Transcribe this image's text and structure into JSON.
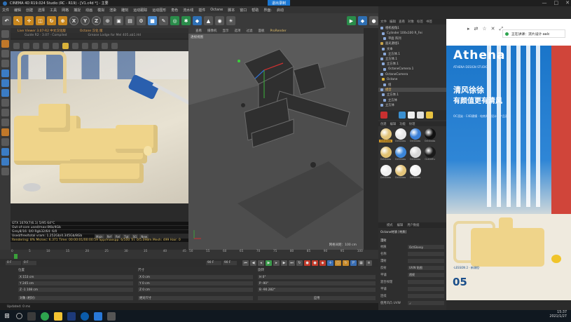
{
  "window": {
    "title": "CINEMA 4D R19.024 Studio (RC - R19) - [V1.c4d *] - 主要",
    "recording_badge": "退出录制",
    "controls": [
      "—",
      "□",
      "✕"
    ]
  },
  "menubar": [
    "文件",
    "编辑",
    "创建",
    "选择",
    "工具",
    "网格",
    "捕捉",
    "动画",
    "模拟",
    "渲染",
    "雕刻",
    "运动跟踪",
    "运动图形",
    "角色",
    "流水线",
    "插件",
    "Octane",
    "脚本",
    "窗口",
    "帮助",
    "界面:",
    "启动"
  ],
  "toolbar": {
    "buttons": [
      {
        "icon": "undo-icon",
        "glyph": "↶",
        "style": ""
      },
      {
        "icon": "select-icon",
        "glyph": "↖",
        "style": "o"
      },
      {
        "icon": "move-icon",
        "glyph": "✛",
        "style": "o"
      },
      {
        "icon": "scale-icon",
        "glyph": "◫",
        "style": "o"
      },
      {
        "icon": "rotate-icon",
        "glyph": "↻",
        "style": "o"
      },
      {
        "icon": "recent-icon",
        "glyph": "⊕",
        "style": "o"
      },
      {
        "icon": "x-axis-icon",
        "glyph": "X",
        "style": "xyz"
      },
      {
        "icon": "y-axis-icon",
        "glyph": "Y",
        "style": "xyz"
      },
      {
        "icon": "z-axis-icon",
        "glyph": "Z",
        "style": "xyz"
      },
      {
        "icon": "coord-system-icon",
        "glyph": "⊙",
        "style": ""
      },
      {
        "icon": "render-view-icon",
        "glyph": "▣",
        "style": ""
      },
      {
        "icon": "render-picture-icon",
        "glyph": "▤",
        "style": ""
      },
      {
        "icon": "render-settings-icon",
        "glyph": "⚙",
        "style": ""
      },
      {
        "icon": "cube-icon",
        "glyph": "■",
        "style": "cube"
      },
      {
        "icon": "pen-icon",
        "glyph": "✎",
        "style": ""
      },
      {
        "icon": "subdivision-icon",
        "glyph": "◎",
        "style": "g"
      },
      {
        "icon": "array-icon",
        "glyph": "✱",
        "style": "g"
      },
      {
        "icon": "deformer-icon",
        "glyph": "◆",
        "style": "b"
      },
      {
        "icon": "environment-icon",
        "glyph": "▲",
        "style": ""
      },
      {
        "icon": "camera-icon",
        "glyph": "◉",
        "style": ""
      },
      {
        "icon": "light-icon",
        "glyph": "☀",
        "style": ""
      }
    ],
    "right_buttons": [
      {
        "icon": "octane-live-icon",
        "glyph": "▶",
        "style": "g"
      },
      {
        "icon": "octane-settings-icon",
        "glyph": "◆",
        "style": "b"
      },
      {
        "icon": "octane-record-icon",
        "glyph": "●",
        "style": ""
      }
    ]
  },
  "left_panel": {
    "header": [
      "Live Viewer 3.07-R2 中文汉化版",
      "Octane 汉化 版"
    ],
    "subheader": [
      "Guide R2 · 3.07 · Compiled",
      "Grease Lodge for Mel 405.ab1.Hd"
    ],
    "stats": [
      "GTX 1070(7(6.1)        5/95         64°C",
      "Out-of-core used/max:0Kb/4Gb",
      "Grey8/16: 0/0        Rgb32/64: 6/0",
      "Used/free/total vram: 1.252Gb/4.345Gb/8Gb",
      "Rendering: 8%   Ms/sec: 6.371   Time: 00:00:01/00:00:59   Spp/maxspp: 6/500   Tri: 0/5.098m   Mesh: 499   Hair: 0"
    ],
    "mode_tabs": [
      "Main",
      "Ref",
      "Rel",
      "Tgt",
      "SG",
      "New"
    ]
  },
  "viewport": {
    "menu": [
      "查看",
      "摄像机",
      "显示",
      "选项",
      "过滤",
      "面板",
      "ProRender"
    ],
    "highlight_index": 6,
    "label": "透视视图",
    "footer_left": "网格间距：100 cm",
    "footer_right": ""
  },
  "right_panel": {
    "tabs": [
      "文件",
      "编辑",
      "查看",
      "对象",
      "标签",
      "书签"
    ],
    "objects": [
      {
        "name": "相机视角1",
        "color": "#8aa8d8",
        "hl": false
      },
      {
        "name": "Cylinder 100x100 R_Fei",
        "color": "#8aa8d8",
        "hl": false
      },
      {
        "name": "平面 阵列",
        "color": "#8aa8d8",
        "hl": false
      },
      {
        "name": "面光源组1",
        "color": "#c8a24a",
        "hl": false
      },
      {
        "name": "文本",
        "color": "#8aa8d8",
        "hl": false
      },
      {
        "name": "立方体.1",
        "color": "#8aa8d8",
        "hl": false
      },
      {
        "name": "立方体.1",
        "color": "#8aa8d8",
        "hl": false
      },
      {
        "name": "立方体.1",
        "color": "#8aa8d8",
        "hl": false
      },
      {
        "name": "OctaneCamera.1",
        "color": "#8aa8d8",
        "hl": false
      },
      {
        "name": "OctaneCamera",
        "color": "#8aa8d8",
        "hl": false
      },
      {
        "name": "Octane",
        "color": "#d9b23a",
        "hl": false
      },
      {
        "name": "组",
        "color": "#8aa8d8",
        "hl": false
      },
      {
        "name": "模型",
        "color": "#8aa8d8",
        "hl": true
      },
      {
        "name": "立方体.1",
        "color": "#8aa8d8",
        "hl": false
      },
      {
        "name": "立方体",
        "color": "#8aa8d8",
        "hl": false
      },
      {
        "name": "立方体",
        "color": "#8aa8d8",
        "hl": false
      }
    ],
    "material_toolbar_colors": [
      "#c83030",
      "#2b2b2b",
      "#3a8fd0",
      "#eeeeee",
      "#e0e0e0",
      "#e8c240"
    ],
    "material_tabs": [
      "创建",
      "编辑",
      "功能",
      "纹理"
    ],
    "materials": [
      {
        "name": "OctGloss",
        "color": "#e2c47a",
        "sel": true
      },
      {
        "name": "OctGloss",
        "color": "#e8e8e8",
        "sel": false
      },
      {
        "name": "OctGloss",
        "color": "#3a7fd6",
        "sel": false
      },
      {
        "name": "OctGloss",
        "color": "#111111",
        "sel": false
      },
      {
        "name": "OctGloss",
        "color": "#e0c070",
        "sel": false
      },
      {
        "name": "OctGloss",
        "color": "#3b85d8",
        "sel": false
      },
      {
        "name": "OctGloss",
        "color": "#d8d8d8",
        "sel": false
      },
      {
        "name": "OctDiffu",
        "color": "#1a1a1a",
        "sel": false
      },
      {
        "name": "OctGloss",
        "color": "#efefef",
        "sel": false
      },
      {
        "name": "OctGloss",
        "color": "#e4c57b",
        "sel": false
      },
      {
        "name": "OctGloss",
        "color": "#f2f2f2",
        "sel": false
      }
    ],
    "attr_tabs": [
      "模式",
      "编辑",
      "用户数据"
    ],
    "attr_title": "Octane材质 [材质]",
    "attr_section": "漫射",
    "attr_rows": [
      {
        "label": "材质",
        "value": "OctGlossy"
      },
      {
        "label": "名称",
        "value": ""
      },
      {
        "label": "漫射",
        "value": ""
      },
      {
        "label": "反射",
        "value": "UVW 贴图"
      },
      {
        "label": "平铺",
        "value": "透视"
      },
      {
        "label": "混合纹理",
        "value": ""
      },
      {
        "label": "平铺",
        "value": ""
      },
      {
        "label": "连续",
        "value": ""
      },
      {
        "label": "使用凹凸 UVW",
        "value": "✓"
      }
    ]
  },
  "right_strip": {
    "icons": [
      "▸",
      "⇄",
      "☆",
      "✕",
      "⤢"
    ],
    "notification": "正在讲课：流片设计·aalc"
  },
  "poster": {
    "title": "Athena",
    "small1": "ATHENA DESIGN STUDIO",
    "line1": "清风徐徐",
    "line2": "有颜值更有清风",
    "small2": "OC渲染 · C4D建模 · 电商海报设计 · 产品渲染",
    "small3": "·LESSON 2 · 新课程·",
    "number": "05"
  },
  "timeline": {
    "left_scale": [
      "0",
      "5",
      "10",
      "15",
      "20",
      "25",
      "30",
      "35",
      "40",
      "45"
    ],
    "right_scale": [
      "50",
      "55",
      "60",
      "65",
      "70",
      "75",
      "80",
      "85",
      "90",
      "95",
      "100"
    ]
  },
  "transport": {
    "start": "0 F",
    "current": "0 F",
    "end": "90 F",
    "end2": "90 F",
    "fps": "0 F"
  },
  "coords": {
    "headers": [
      "位置",
      "尺寸",
      "旋转"
    ],
    "pos": [
      "X 153 cm",
      "Y 245 cm",
      "Z -1 108 cm"
    ],
    "size": [
      "X 0 cm",
      "Y 0 cm",
      "Z 0 cm"
    ],
    "rot": [
      "H 0°",
      "P -90°",
      "B -90.282°"
    ],
    "mode_left": "对象 (相对)",
    "mode_mid": "绝对尺寸",
    "apply": "应用"
  },
  "statusbar": "Updated: 0 ms",
  "tray": {
    "time": "15:37",
    "date": "2021/1/27"
  }
}
